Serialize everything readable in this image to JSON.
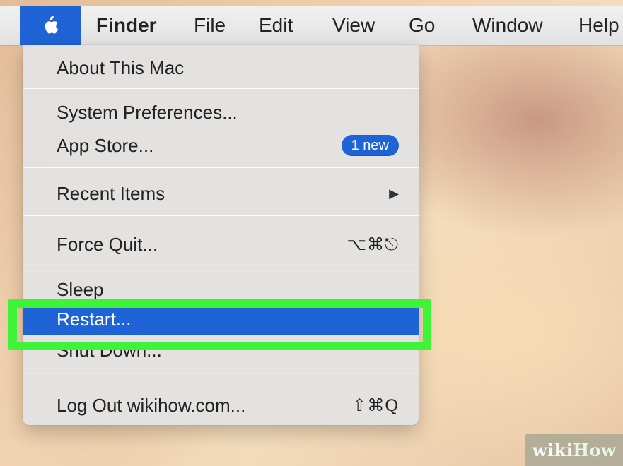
{
  "menubar": {
    "apple_icon": "apple-logo-icon",
    "items": [
      "Finder",
      "File",
      "Edit",
      "View",
      "Go",
      "Window",
      "Help"
    ]
  },
  "apple_menu": {
    "items": [
      {
        "label": "About This Mac"
      },
      {
        "label": "System Preferences..."
      },
      {
        "label": "App Store...",
        "badge": "1 new"
      },
      {
        "label": "Recent Items",
        "submenu_icon": "submenu-arrow-icon",
        "submenu_glyph": "▶"
      },
      {
        "label": "Force Quit...",
        "shortcut": "⌥⌘⎋"
      },
      {
        "label": "Sleep"
      },
      {
        "label": "Restart...",
        "selected": true
      },
      {
        "label": "Shut Down..."
      },
      {
        "label": "Log Out wikihow.com...",
        "shortcut": "⇧⌘Q"
      }
    ]
  },
  "watermark": {
    "wiki": "wiki",
    "how": "How"
  },
  "colors": {
    "selection": "#1f64d6",
    "annotation_box": "#3df438",
    "menu_bg": "#e2e2e2",
    "badge_bg": "#1f64d6"
  }
}
